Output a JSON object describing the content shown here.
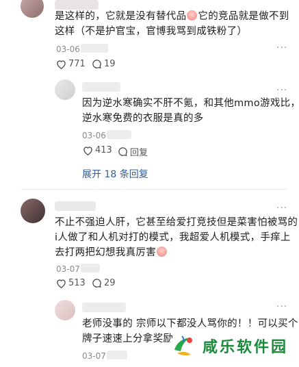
{
  "comments": [
    {
      "line1_a": "是这样的，它就是没有替代品",
      "line1_b": "它的竞品就是做不到",
      "line2": "这样（不是护官宝，官博我骂到成铁粉了）",
      "date": "03-06",
      "likes": "771",
      "replies": "19"
    },
    {
      "line1": "因为逆水寒确实不肝不氪，和其他mmo游戏比，",
      "line2": "逆水寒免费的衣服是真的多",
      "date": "03-06",
      "likes": "413",
      "reply_label": "回复"
    },
    {
      "line1": "不止不强迫人肝，它甚至给爱打竞技但是菜害怕被骂的",
      "line2": "i人做了和人机对打的模式，我超爱人机模式，手痒上",
      "line3": "去打两把幻想我真厉害",
      "date": "03-07",
      "likes": "513",
      "replies": "29"
    },
    {
      "line1": "老师没事的 宗师以下都没人骂你的！！可以买个",
      "line2": "牌子速速上分拿奖励",
      "date": "03-07"
    }
  ],
  "expand_label": "展开 18 条回复",
  "more_label": "···",
  "watermark": {
    "text": "咸乐软件园",
    "color": "#1b8a3b"
  },
  "colors": {
    "link": "#2f5c9c",
    "meta": "#8a8a8a"
  }
}
